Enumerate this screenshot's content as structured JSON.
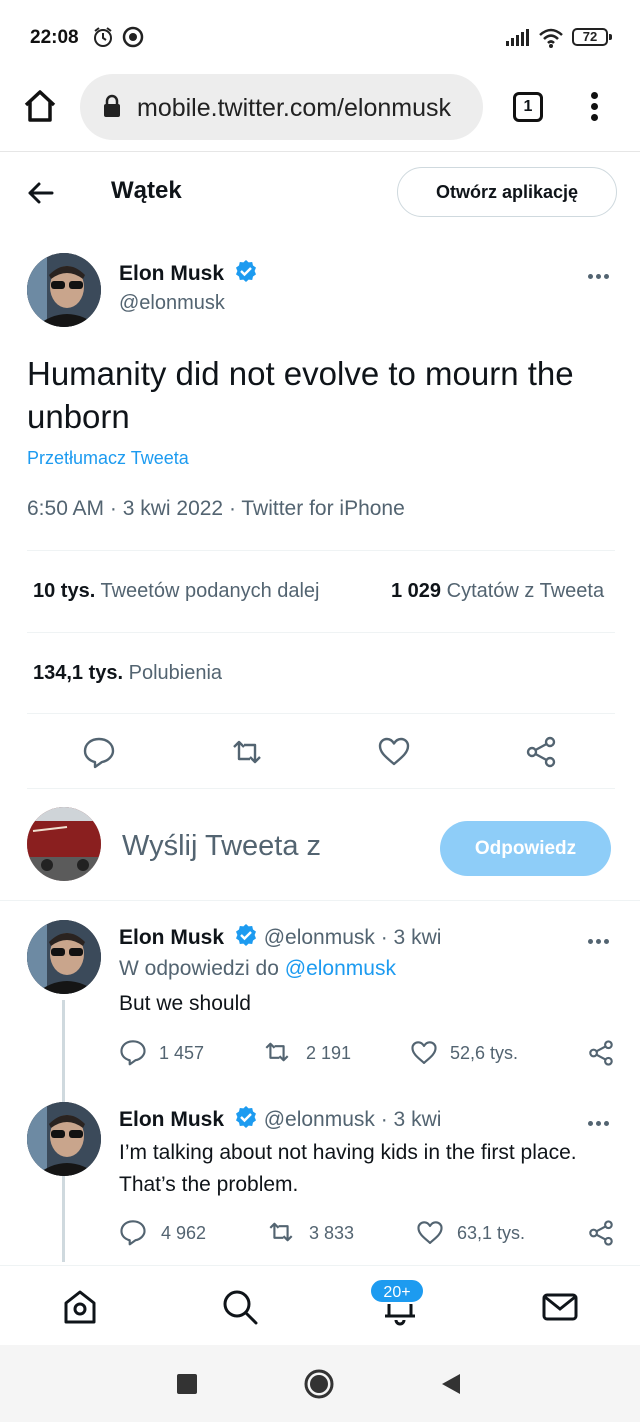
{
  "status_bar": {
    "time": "22:08",
    "battery": "72"
  },
  "browser": {
    "url": "mobile.twitter.com/elonmusk",
    "tab_count": "1"
  },
  "header": {
    "title": "Wątek",
    "open_app_label": "Otwórz aplikację"
  },
  "main_tweet": {
    "author_name": "Elon Musk",
    "author_handle": "@elonmusk",
    "text": "Humanity did not evolve to mourn the unborn",
    "translate_label": "Przetłumacz Tweeta",
    "meta": "6:50 AM · 3 kwi 2022 · Twitter for iPhone",
    "retweets_count": "10 tys.",
    "retweets_label": "Tweetów podanych dalej",
    "quotes_count": "1 029",
    "quotes_label": "Cytatów z Tweeta",
    "likes_count": "134,1 tys.",
    "likes_label": "Polubienia"
  },
  "composer": {
    "prompt": "Wyślij Tweeta z",
    "reply_button": "Odpowiedz"
  },
  "replies": [
    {
      "author_name": "Elon Musk",
      "author_handle": "@elonmusk · 3 kwi",
      "reply_to_prefix": "W odpowiedzi do",
      "reply_to_handle": "@elonmusk",
      "text": "But we should",
      "reply_count": "1 457",
      "retweet_count": "2 191",
      "like_count": "52,6 tys."
    },
    {
      "author_name": "Elon Musk",
      "author_handle": "@elonmusk · 3 kwi",
      "text": "I’m talking about not having kids in the first place. That’s the problem.",
      "reply_count": "4 962",
      "retweet_count": "3 833",
      "like_count": "63,1 tys."
    }
  ],
  "bottom_nav": {
    "notifications_badge": "20+"
  },
  "colors": {
    "accent": "#1d9bf0",
    "reply_button_disabled": "#8ecdf8",
    "muted_text": "#536471"
  },
  "icons": [
    "alarm-icon",
    "record-icon",
    "signal-icon",
    "wifi-icon",
    "battery-icon",
    "home-icon",
    "lock-icon",
    "tabs-icon",
    "menu-icon",
    "back-arrow-icon",
    "more-icon",
    "verified-icon",
    "reply-icon",
    "retweet-icon",
    "like-icon",
    "share-icon",
    "twitter-home-icon",
    "search-icon",
    "bell-icon",
    "mail-icon",
    "square-icon",
    "circle-icon",
    "triangle-back-icon"
  ]
}
